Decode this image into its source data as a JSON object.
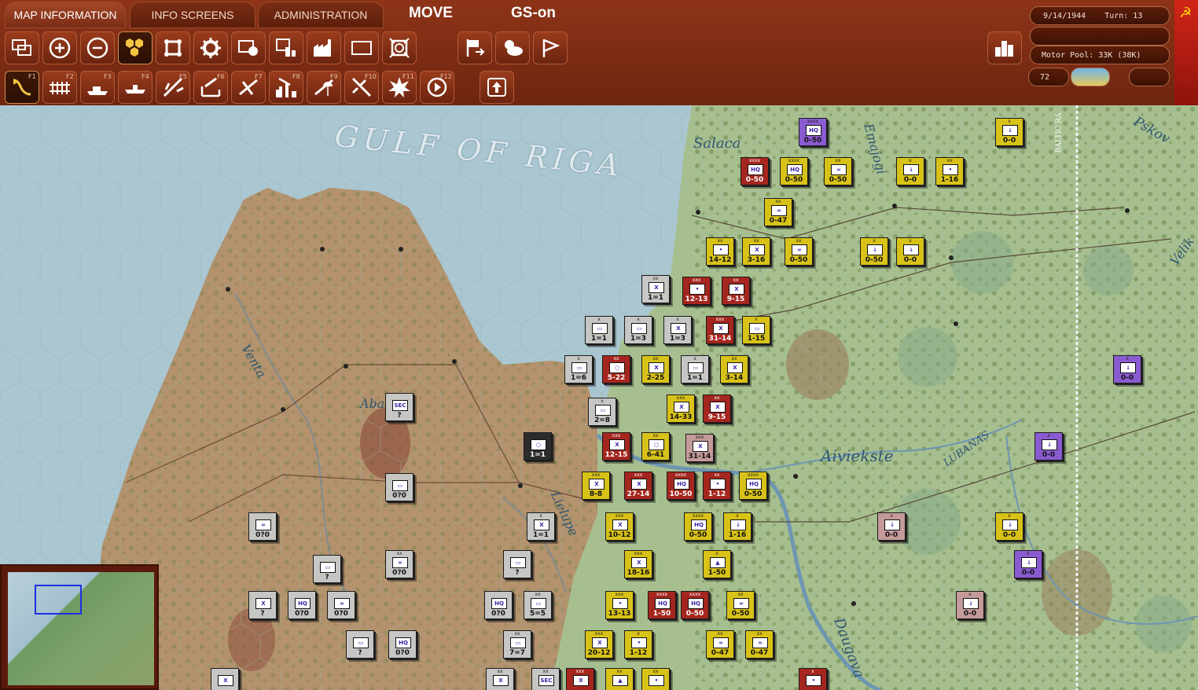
{
  "tabs": [
    "MAP INFORMATION",
    "INFO SCREENS",
    "ADMINISTRATION"
  ],
  "mode": "MOVE",
  "gs_status": "GS-on",
  "toolbar_row1": [
    "layers-icon",
    "zoom-in-icon",
    "zoom-out-icon",
    "hex-grid-icon",
    "unit-bases-icon",
    "gear-icon",
    "unit-counter-icon",
    "stack-icon",
    "factory-icon",
    "frame-icon",
    "cover-icon"
  ],
  "toolbar_row1b": [
    "flag-export-icon",
    "weather-icon",
    "flag-icon"
  ],
  "toolbar_row2": [
    {
      "icon": "move-icon",
      "key": "F1"
    },
    {
      "icon": "rail-icon",
      "key": "F2"
    },
    {
      "icon": "naval-icon",
      "key": "F3"
    },
    {
      "icon": "ship-icon",
      "key": "F4"
    },
    {
      "icon": "air-transfer-icon",
      "key": "F5"
    },
    {
      "icon": "air-recon-icon",
      "key": "F6"
    },
    {
      "icon": "air-strike-icon",
      "key": "F7"
    },
    {
      "icon": "bomb-city-icon",
      "key": "F8"
    },
    {
      "icon": "paradrop-icon",
      "key": "F9"
    },
    {
      "icon": "air-attack-icon",
      "key": "F10"
    },
    {
      "icon": "explosion-icon",
      "key": "F11"
    },
    {
      "icon": "end-icon",
      "key": "F12"
    }
  ],
  "info": {
    "date": "9/14/1944",
    "turn": "Turn: 13",
    "motor_pool": "Motor Pool: 33K (38K)",
    "value": "72"
  },
  "map_labels": {
    "gulf": "GULF OF RIGA",
    "salaca": "Salaca",
    "venta": "Venta",
    "abava": "Abava",
    "lielupe": "Lielupe",
    "aiviekste": "Aiviekste",
    "lubanas": "LUBANAS",
    "daugava": "Daugava",
    "pskov": "Pskov",
    "velikaya": "Velik",
    "emajogi": "Emajogi",
    "baltic": "BALTIC RA"
  },
  "units": [
    {
      "c": "p",
      "s": "HQ",
      "str": "0-50",
      "z": "xxxx"
    },
    {
      "c": "r",
      "s": "HQ",
      "str": "0-50",
      "z": "xxxx"
    },
    {
      "c": "y",
      "s": "HQ",
      "str": "0-50",
      "z": "xxxx"
    },
    {
      "c": "y",
      "s": "∞",
      "str": "0-50",
      "z": "xx"
    },
    {
      "c": "y",
      "s": "↓",
      "str": "0-0",
      "z": "x"
    },
    {
      "c": "y",
      "s": "•",
      "str": "1-16",
      "z": "xx"
    },
    {
      "c": "y",
      "s": "↓",
      "str": "0-0",
      "z": "x"
    },
    {
      "c": "y",
      "s": "∞",
      "str": "0-47",
      "z": "xx"
    },
    {
      "c": "y",
      "s": "•",
      "str": "14-12",
      "z": "xx"
    },
    {
      "c": "y",
      "s": "X",
      "str": "3-16",
      "z": "xx"
    },
    {
      "c": "y",
      "s": "∞",
      "str": "0-50",
      "z": "xx"
    },
    {
      "c": "y",
      "s": "↓",
      "str": "0-50",
      "z": "x"
    },
    {
      "c": "y",
      "s": "↓",
      "str": "0-0",
      "z": "x"
    },
    {
      "c": "g",
      "s": "X",
      "str": "1=1",
      "z": "xx"
    },
    {
      "c": "r",
      "s": "•",
      "str": "12-13",
      "z": "xxx"
    },
    {
      "c": "r",
      "s": "X",
      "str": "9-15",
      "z": "xx"
    },
    {
      "c": "g",
      "s": "▭",
      "str": "1=1",
      "z": "x"
    },
    {
      "c": "g",
      "s": "▭",
      "str": "1=3",
      "z": "x"
    },
    {
      "c": "g",
      "s": "X",
      "str": "1=3",
      "z": "x"
    },
    {
      "c": "r",
      "s": "X",
      "str": "31-14",
      "z": "xxx"
    },
    {
      "c": "y",
      "s": "▭",
      "str": "1-15",
      "z": "x"
    },
    {
      "c": "g",
      "s": "▭",
      "str": "1=6",
      "z": "x"
    },
    {
      "c": "r",
      "s": "○",
      "str": "5-22",
      "z": "xx"
    },
    {
      "c": "y",
      "s": "X",
      "str": "2-25",
      "z": "xx"
    },
    {
      "c": "g",
      "s": "▭",
      "str": "1=1",
      "z": "x"
    },
    {
      "c": "y",
      "s": "X",
      "str": "3-14",
      "z": "xx"
    },
    {
      "c": "p",
      "s": "↓",
      "str": "0-0",
      "z": "x"
    },
    {
      "c": "g",
      "s": "▭",
      "str": "2=8",
      "z": "x"
    },
    {
      "c": "y",
      "s": "X",
      "str": "14-33",
      "z": "xxx"
    },
    {
      "c": "r",
      "s": "X",
      "str": "9-15",
      "z": "xx"
    },
    {
      "c": "g",
      "s": "SEC",
      "str": "?",
      "z": ""
    },
    {
      "c": "dk",
      "s": "○",
      "str": "1=1",
      "z": "x"
    },
    {
      "c": "r",
      "s": "X",
      "str": "12-15",
      "z": "xxx"
    },
    {
      "c": "y",
      "s": "○",
      "str": "6-41",
      "z": "xx"
    },
    {
      "c": "pk",
      "s": "X",
      "str": "31-14",
      "z": "xxx"
    },
    {
      "c": "p",
      "s": "↓",
      "str": "0-0",
      "z": "x"
    },
    {
      "c": "g",
      "s": "▭",
      "str": "0?0",
      "z": ""
    },
    {
      "c": "y",
      "s": "X",
      "str": "8-8",
      "z": "xxx"
    },
    {
      "c": "r",
      "s": "X",
      "str": "27-14",
      "z": "xxx"
    },
    {
      "c": "r",
      "s": "HQ",
      "str": "10-50",
      "z": "xxxx"
    },
    {
      "c": "r",
      "s": "•",
      "str": "1-12",
      "z": "xx"
    },
    {
      "c": "y",
      "s": "HQ",
      "str": "0-50",
      "z": "xxxx"
    },
    {
      "c": "g",
      "s": "∞",
      "str": "0?0",
      "z": ""
    },
    {
      "c": "g",
      "s": "X",
      "str": "1=1",
      "z": "x"
    },
    {
      "c": "y",
      "s": "X",
      "str": "10-12",
      "z": "xxx"
    },
    {
      "c": "y",
      "s": "HQ",
      "str": "0-50",
      "z": "xxxx"
    },
    {
      "c": "y",
      "s": "↓",
      "str": "1-16",
      "z": "x"
    },
    {
      "c": "pk",
      "s": "↓",
      "str": "0-0",
      "z": "x"
    },
    {
      "c": "y",
      "s": "↓",
      "str": "0-0",
      "z": "x"
    },
    {
      "c": "g",
      "s": "▭",
      "str": "?",
      "z": ""
    },
    {
      "c": "g",
      "s": "∞",
      "str": "0?0",
      "z": "xx"
    },
    {
      "c": "g",
      "s": "▭",
      "str": "?",
      "z": ""
    },
    {
      "c": "y",
      "s": "X",
      "str": "18-16",
      "z": "xxx"
    },
    {
      "c": "y",
      "s": "▲",
      "str": "1-50",
      "z": "x"
    },
    {
      "c": "p",
      "s": "↓",
      "str": "0-0",
      "z": "x"
    },
    {
      "c": "g",
      "s": "X",
      "str": "?",
      "z": ""
    },
    {
      "c": "g",
      "s": "HQ",
      "str": "0?0",
      "z": ""
    },
    {
      "c": "g",
      "s": "∞",
      "str": "0?0",
      "z": ""
    },
    {
      "c": "g",
      "s": "HQ",
      "str": "0?0",
      "z": ""
    },
    {
      "c": "g",
      "s": "▭",
      "str": "5=5",
      "z": "xx"
    },
    {
      "c": "y",
      "s": "•",
      "str": "13-13",
      "z": "xxx"
    },
    {
      "c": "r",
      "s": "HQ",
      "str": "1-50",
      "z": "xxxx"
    },
    {
      "c": "r",
      "s": "HQ",
      "str": "0-50",
      "z": "xxxx"
    },
    {
      "c": "y",
      "s": "∞",
      "str": "0-50",
      "z": "xx"
    },
    {
      "c": "pk",
      "s": "↓",
      "str": "0-0",
      "z": "x"
    },
    {
      "c": "g",
      "s": "▭",
      "str": "?",
      "z": ""
    },
    {
      "c": "g",
      "s": "HQ",
      "str": "0?0",
      "z": ""
    },
    {
      "c": "g",
      "s": "▭",
      "str": "7=7",
      "z": "xx"
    },
    {
      "c": "y",
      "s": "X",
      "str": "20-12",
      "z": "xxx"
    },
    {
      "c": "y",
      "s": "•",
      "str": "1-12",
      "z": "x"
    },
    {
      "c": "y",
      "s": "∞",
      "str": "0-47",
      "z": "xx"
    },
    {
      "c": "y",
      "s": "∞",
      "str": "0-47",
      "z": "xx"
    },
    {
      "c": "g",
      "s": "X",
      "str": "",
      "z": ""
    },
    {
      "c": "g",
      "s": "X",
      "str": "",
      "z": "xx"
    },
    {
      "c": "g",
      "s": "SEC",
      "str": "",
      "z": "xx"
    },
    {
      "c": "r",
      "s": "X",
      "str": "",
      "z": "xxx"
    },
    {
      "c": "y",
      "s": "▲",
      "str": "",
      "z": "xx"
    },
    {
      "c": "y",
      "s": "•",
      "str": "",
      "z": "xx"
    },
    {
      "c": "r",
      "s": "•",
      "str": "",
      "z": "x"
    }
  ]
}
